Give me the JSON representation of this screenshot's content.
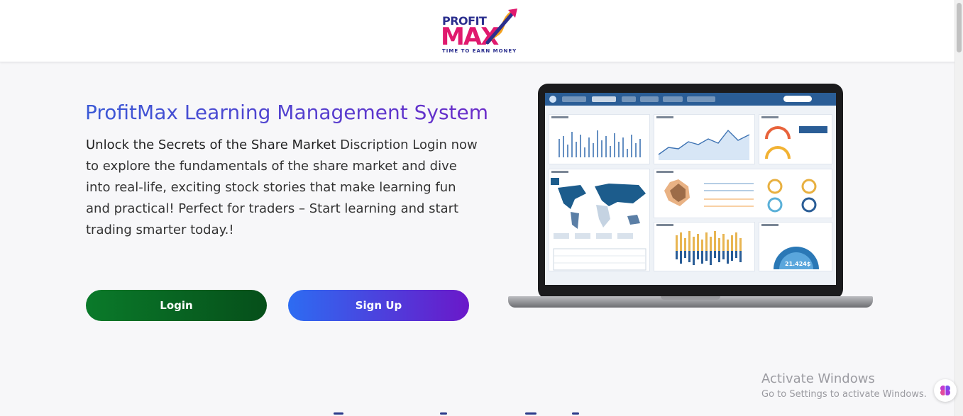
{
  "brand": {
    "logo_top": "PROFIT",
    "logo_main": "MAX",
    "tagline": "TIME TO EARN MONEY",
    "colors": {
      "navy": "#2b2f8e",
      "magenta": "#e0196e",
      "orange": "#f5a11c"
    }
  },
  "hero": {
    "title": "ProfitMax Learning Management System",
    "desc_bold": "Unlock the Secrets of the Share Market",
    "desc_rest": " Discription Login now to explore the fundamentals of the share market and dive into real-life, exciting stock stories that make learning fun and practical! Perfect for traders – Start learning and start trading smarter today.!"
  },
  "buttons": {
    "login": "Login",
    "signup": "Sign Up",
    "login_colors": [
      "#0a7a2a",
      "#064f1a"
    ],
    "signup_colors": [
      "#2d6cf2",
      "#6a18c9"
    ]
  },
  "dashboard_image": {
    "gauge_value": "21.424$"
  },
  "windows": {
    "activate_title": "Activate Windows",
    "activate_sub": "Go to Settings to activate Windows."
  },
  "icons": [
    "brain-icon",
    "arrow-up-right-icon"
  ]
}
